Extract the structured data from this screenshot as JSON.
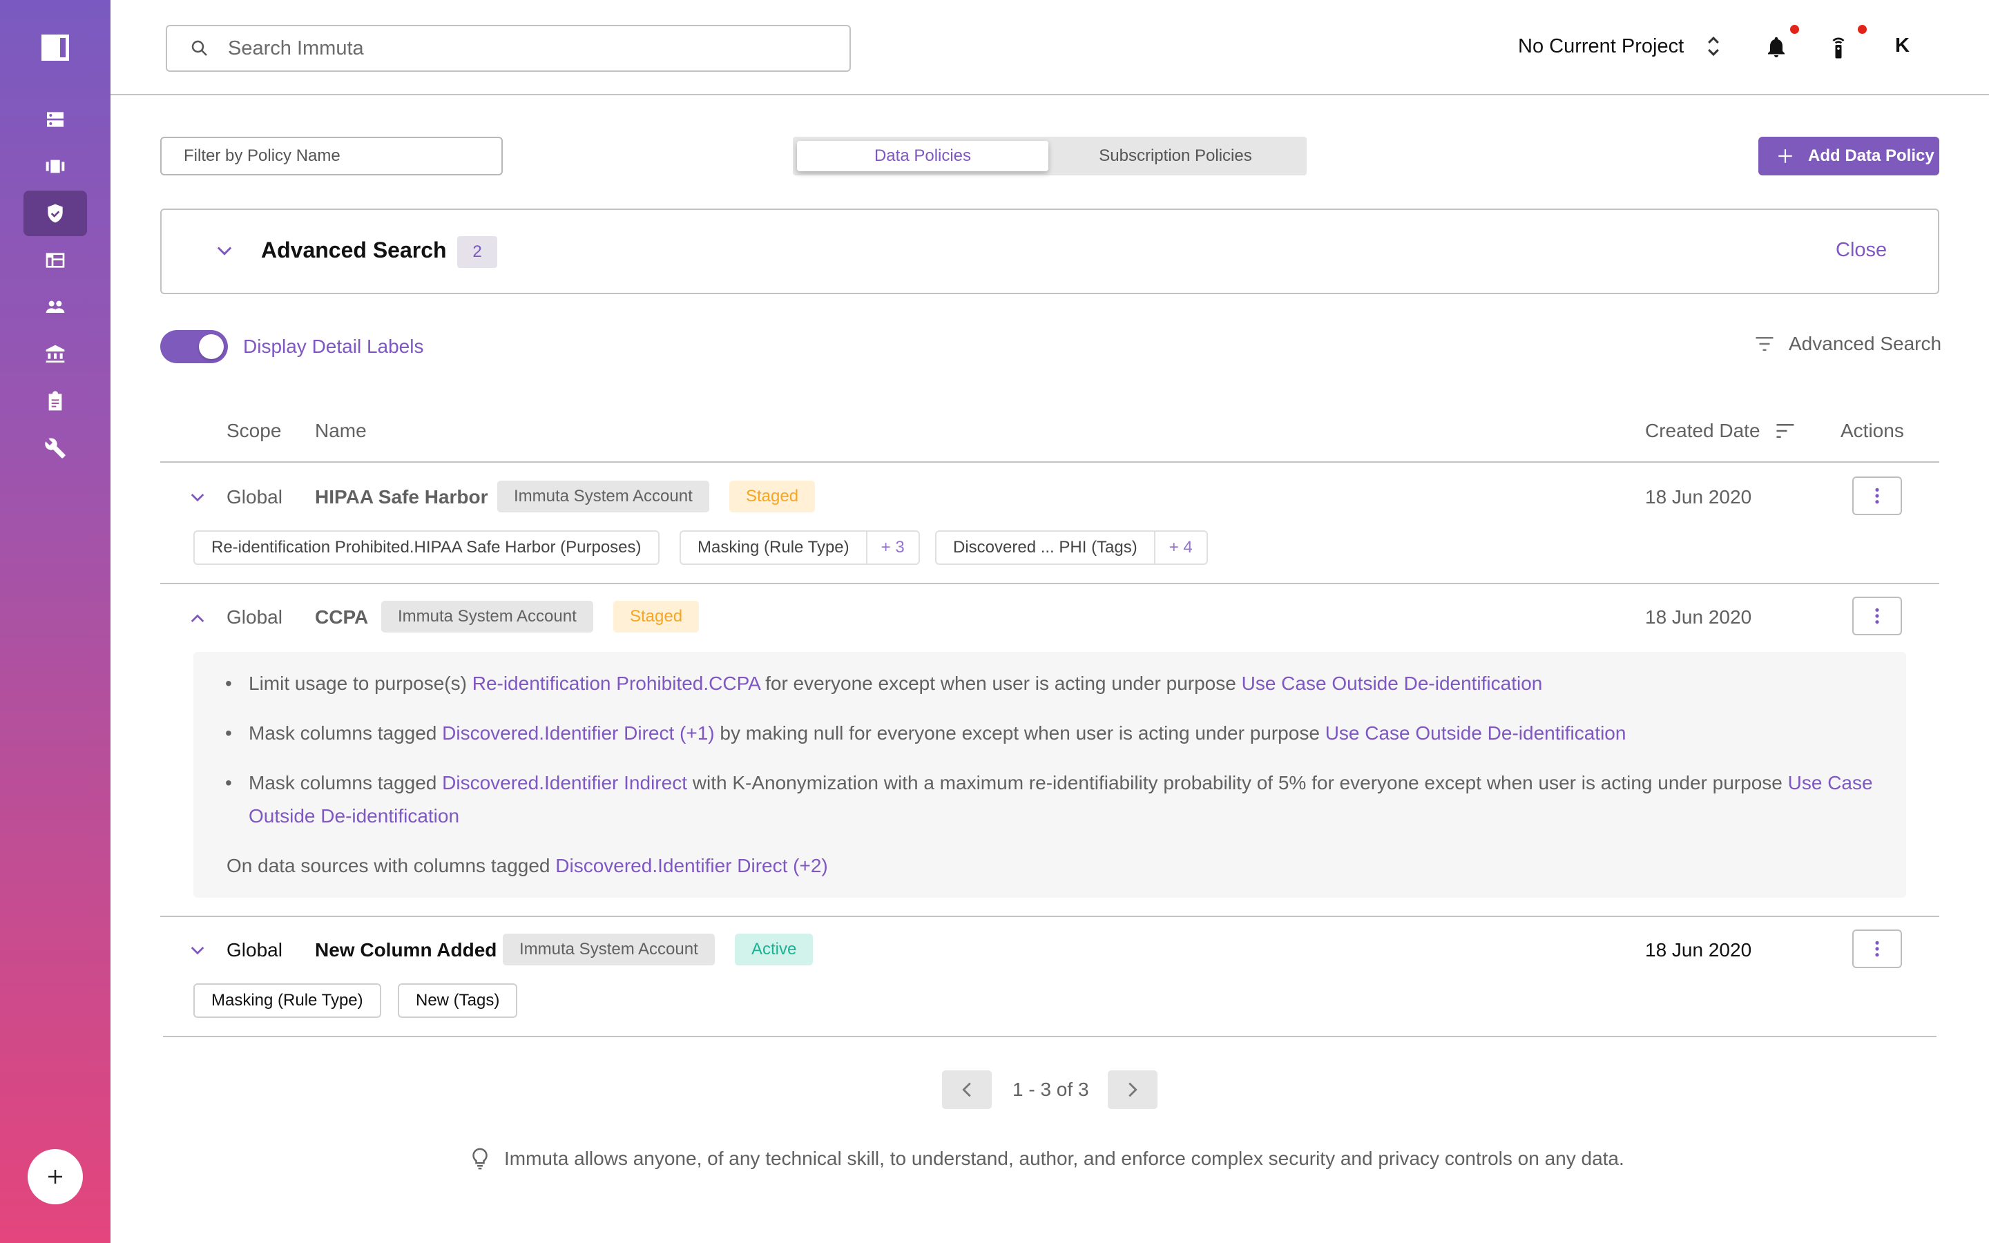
{
  "sidebar": {
    "items": [
      {
        "icon": "data-sources-icon",
        "label": "Data Sources"
      },
      {
        "icon": "projects-icon",
        "label": "Projects"
      },
      {
        "icon": "policies-shield-icon",
        "label": "Policies",
        "active": true
      },
      {
        "icon": "table-icon",
        "label": "Query Editor"
      },
      {
        "icon": "people-icon",
        "label": "People"
      },
      {
        "icon": "governance-icon",
        "label": "Governance"
      },
      {
        "icon": "audit-clipboard-icon",
        "label": "Audit"
      },
      {
        "icon": "wrench-icon",
        "label": "App Settings"
      }
    ],
    "fab_icon": "plus-icon"
  },
  "header": {
    "search_placeholder": "Search Immuta",
    "project_label": "No Current Project",
    "notifications_icon": "bell-icon",
    "remote_icon": "remote-icon",
    "avatar_initial": "K"
  },
  "toolbar": {
    "filter_placeholder": "Filter by Policy Name",
    "tabs": [
      {
        "label": "Data Policies",
        "active": true
      },
      {
        "label": "Subscription Policies",
        "active": false
      }
    ],
    "add_button": "Add Data Policy"
  },
  "advanced_search": {
    "title": "Advanced Search",
    "count": "2",
    "close_label": "Close",
    "toggle_label": "Display Detail Labels",
    "toggle_on": true,
    "link_label": "Advanced Search"
  },
  "table": {
    "columns": {
      "scope": "Scope",
      "name": "Name",
      "created": "Created Date",
      "actions": "Actions"
    },
    "rows": [
      {
        "scope": "Global",
        "name": "HIPAA Safe Harbor",
        "owner": "Immuta System Account",
        "status": "Staged",
        "created": "18 Jun 2020",
        "expanded": false,
        "chips": [
          {
            "label": "Re-identification Prohibited.HIPAA Safe Harbor (Purposes)"
          },
          {
            "label": "Masking (Rule Type)",
            "more": "+ 3"
          },
          {
            "label": "Discovered ... PHI (Tags)",
            "more": "+ 4"
          }
        ]
      },
      {
        "scope": "Global",
        "name": "CCPA",
        "owner": "Immuta System Account",
        "status": "Staged",
        "created": "18 Jun 2020",
        "expanded": true,
        "details": [
          {
            "before": "Limit usage to purpose(s) ",
            "link1": "Re-identification Prohibited.CCPA",
            "middle": " for everyone except when user is acting under purpose ",
            "link2": "Use Case Outside De-identification"
          },
          {
            "before": "Mask columns tagged ",
            "link1": "Discovered.Identifier Direct (+1)",
            "middle": " by making null for everyone except when user is acting under purpose ",
            "link2": "Use Case Outside De-identification"
          },
          {
            "before": "Mask columns tagged ",
            "link1": "Discovered.Identifier Indirect",
            "middle": " with K-Anonymization with a maximum re-identifiability probability of 5% for everyone except when user is acting under purpose ",
            "link2": "Use Case Outside De-identification"
          }
        ],
        "datasource_text": "On data sources with columns tagged ",
        "datasource_link": "Discovered.Identifier Direct (+2)"
      },
      {
        "scope": "Global",
        "name": "New Column Added",
        "owner": "Immuta System Account",
        "status": "Active",
        "created": "18 Jun 2020",
        "expanded": false,
        "chips": [
          {
            "label": "Masking (Rule Type)"
          },
          {
            "label": "New (Tags)"
          }
        ]
      }
    ]
  },
  "pagination": {
    "text": "1 - 3 of 3"
  },
  "footer": {
    "tip": "Immuta allows anyone, of any technical skill, to understand, author, and enforce complex security and privacy controls on any data."
  },
  "colors": {
    "accent": "#7e57c2",
    "staged": "#f5a623",
    "active": "#19b394",
    "notification": "#e2231a"
  }
}
